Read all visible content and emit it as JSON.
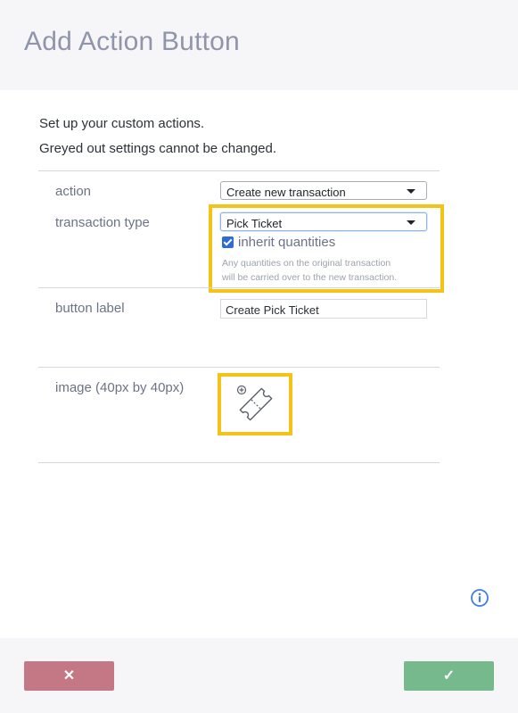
{
  "dialog": {
    "title": "Add Action Button",
    "intro_line1": "Set up your custom actions.",
    "intro_line2": "Greyed out settings cannot be changed."
  },
  "form": {
    "action": {
      "label": "action",
      "value": "Create new transaction"
    },
    "transaction_type": {
      "label": "transaction type",
      "value": "Pick Ticket"
    },
    "inherit_quantities": {
      "label": "inherit quantities",
      "checked": true,
      "help_line1": "Any quantities on the original transaction",
      "help_line2": "will be carried over to the new transaction."
    },
    "button_label": {
      "label": "button label",
      "value": "Create Pick Ticket"
    },
    "image": {
      "label": "image (40px by 40px)",
      "icon": "ticket-icon"
    }
  },
  "footer": {
    "cancel_symbol": "✕",
    "confirm_symbol": "✓"
  },
  "colors": {
    "highlight": "#f3c318",
    "cancel": "#c47785",
    "confirm": "#76b98d",
    "info": "#3f7fe0"
  }
}
